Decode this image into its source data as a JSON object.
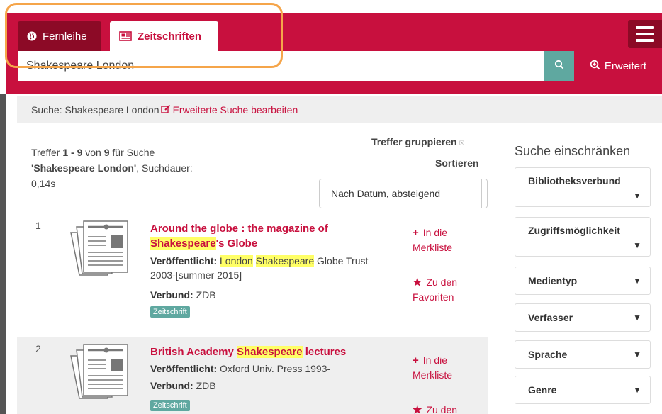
{
  "header": {
    "tabs": [
      {
        "label": "Fernleihe",
        "icon": "globe-icon"
      },
      {
        "label": "Zeitschriften",
        "icon": "newspaper-icon"
      }
    ],
    "menu_icon": "hamburger-menu-icon"
  },
  "search": {
    "value": "Shakespeare London",
    "button_icon": "search-icon",
    "advanced_label": "Erweitert"
  },
  "querybar": {
    "prefix": "Suche: Shakespeare London",
    "edit_label": "Erweiterte Suche bearbeiten"
  },
  "results_info": {
    "t1": "Treffer ",
    "range": "1 - 9",
    "t2": " von ",
    "total": "9",
    "t3": " für Suche",
    "query": "'Shakespeare London'",
    "t4": ", Suchdauer:",
    "duration": "0,14s"
  },
  "controls": {
    "group_label": "Treffer gruppieren",
    "sort_label": "Sortieren",
    "sort_value": "Nach Datum, absteigend"
  },
  "results": [
    {
      "number": "1",
      "title_a": "Around the globe : the magazine of ",
      "title_hl": "Shakespeare",
      "title_b": "'s Globe",
      "published_label": "Veröffentlicht:",
      "pub_hl1": "London",
      "pub_hl2": "Shakespeare",
      "pub_rest": " Globe Trust 2003-[summer 2015]",
      "verbund_label": "Verbund:",
      "verbund": "ZDB",
      "badge": "Zeitschrift",
      "action1": "In die Merkliste",
      "action2": "Zu den Favoriten"
    },
    {
      "number": "2",
      "title_a": "British Academy ",
      "title_hl": "Shakespeare",
      "title_b": " lectures",
      "published_label": "Veröffentlicht:",
      "published": "Oxford Univ. Press 1993-",
      "verbund_label": "Verbund:",
      "verbund": "ZDB",
      "badge": "Zeitschrift",
      "action1": "In die Merkliste",
      "action2": "Zu den"
    }
  ],
  "sidebar": {
    "title": "Suche einschränken",
    "facets": [
      "Bibliotheksverbund",
      "Zugriffsmöglichkeit",
      "Medientyp",
      "Verfasser",
      "Sprache",
      "Genre"
    ]
  },
  "colors": {
    "brand": "#c8103e",
    "brand_dark": "#8c0a26",
    "teal": "#5fa8a0",
    "highlight": "#ffff66",
    "callout": "#f5a54a"
  }
}
